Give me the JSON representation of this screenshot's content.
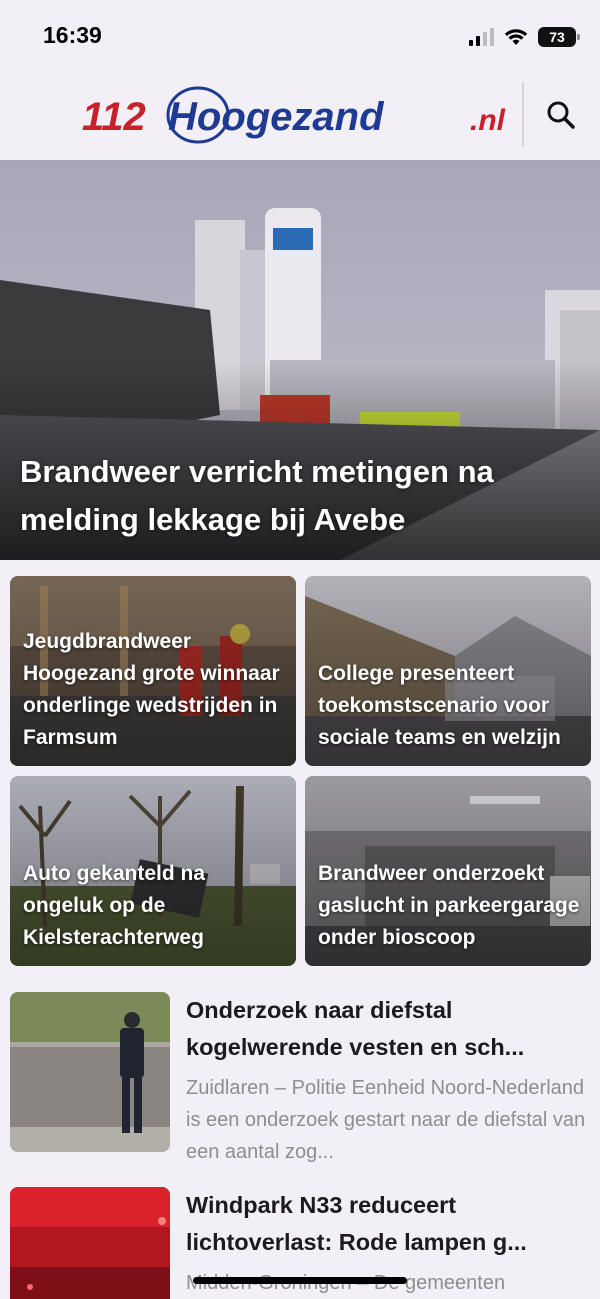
{
  "status_bar": {
    "time": "16:39",
    "battery": "73",
    "icons": [
      "signal-icon",
      "wifi-icon",
      "battery-icon"
    ]
  },
  "header": {
    "logo_text": "112Hoogezand.nl",
    "logo_part_number": "112",
    "logo_part_name": "Hoogezand",
    "logo_part_tld": ".nl",
    "search_icon": "search-icon",
    "colors": {
      "red": "#c8202b",
      "blue": "#1f3a93"
    }
  },
  "hero": {
    "title": "Brandweer verricht metingen na melding lekkage bij Avebe"
  },
  "grid": [
    {
      "title": "Jeugdbrandweer Hoogezand grote winnaar onderlinge wedstrijden in Farmsum"
    },
    {
      "title": "College presenteert toekomstscenario voor sociale teams en welzijn"
    },
    {
      "title": "Auto gekanteld na ongeluk op de Kielsterachterweg"
    },
    {
      "title": "Brandweer onderzoekt gaslucht in parkeergarage onder bioscoop"
    }
  ],
  "list": [
    {
      "title": "Onderzoek naar diefstal kogelwerende vesten en sch...",
      "excerpt": "Zuidlaren – Politie Eenheid Noord-Nederland is een onderzoek gestart naar de diefstal van een aantal zog..."
    },
    {
      "title": "Windpark N33 reduceert lichtoverlast: Rode lampen g...",
      "excerpt": "Midden-Groningen – De gemeenten"
    }
  ]
}
